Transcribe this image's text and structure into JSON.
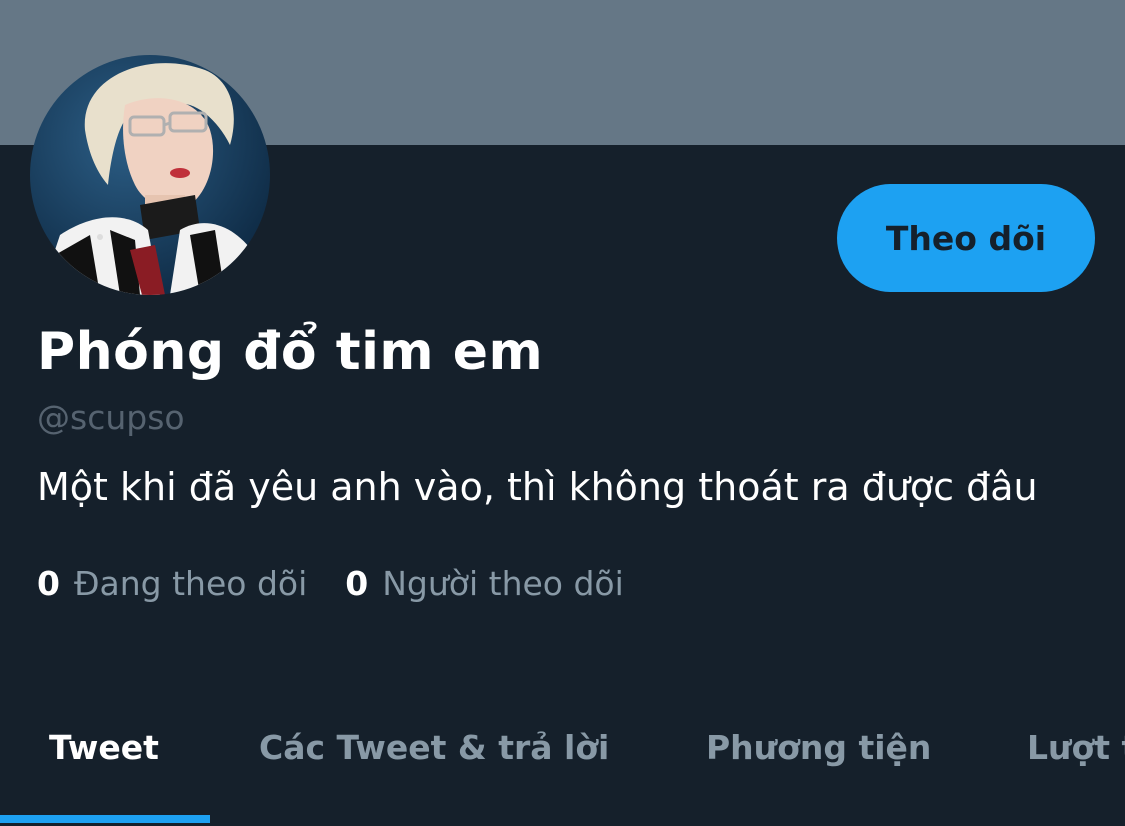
{
  "profile": {
    "display_name": "Phóng đổ tim em",
    "handle": "@scupso",
    "bio": "Một khi đã yêu anh vào, thì không thoát ra được đâu",
    "avatar": "profile-photo"
  },
  "actions": {
    "follow_label": "Theo dõi"
  },
  "stats": {
    "following_count": "0",
    "following_label": "Đang theo dõi",
    "followers_count": "0",
    "followers_label": "Người theo dõi"
  },
  "tabs": [
    {
      "label": "Tweet",
      "active": true
    },
    {
      "label": "Các Tweet & trả lời",
      "active": false
    },
    {
      "label": "Phương tiện",
      "active": false
    },
    {
      "label": "Lượt thích",
      "active": false
    }
  ],
  "colors": {
    "background": "#15202b",
    "banner": "#657786",
    "accent": "#1da1f2",
    "muted_text": "#8899a6"
  }
}
